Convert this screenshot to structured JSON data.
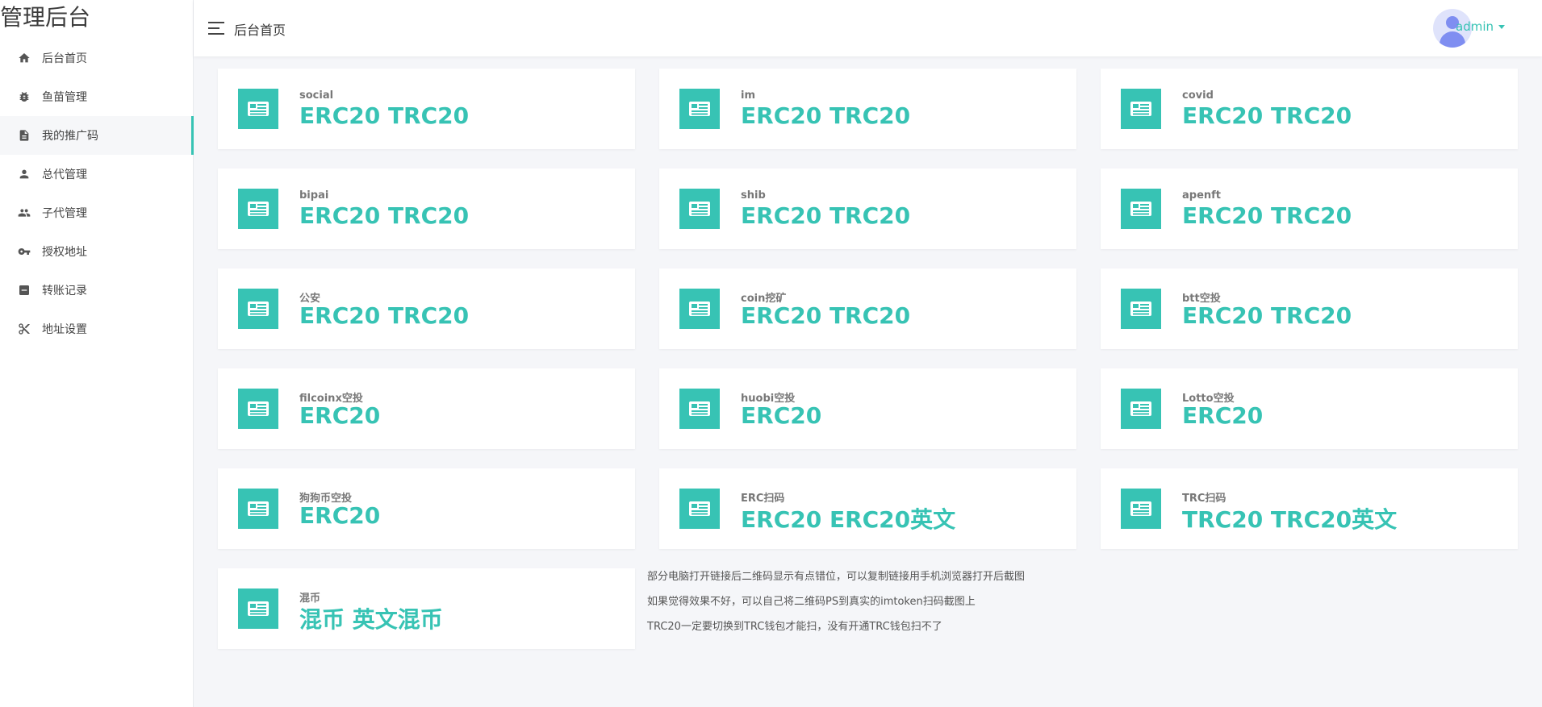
{
  "sidebar": {
    "brand": "管理后台",
    "items": [
      {
        "label": "后台首页",
        "icon": "home-icon"
      },
      {
        "label": "鱼苗管理",
        "icon": "bug-icon"
      },
      {
        "label": "我的推广码",
        "icon": "document-icon"
      },
      {
        "label": "总代管理",
        "icon": "person-icon"
      },
      {
        "label": "子代管理",
        "icon": "people-icon"
      },
      {
        "label": "授权地址",
        "icon": "key-icon"
      },
      {
        "label": "转账记录",
        "icon": "list-icon"
      },
      {
        "label": "地址设置",
        "icon": "scissors-icon"
      }
    ],
    "active_index": 2
  },
  "header": {
    "title": "后台首页",
    "user": "admin"
  },
  "cards": [
    {
      "label": "social",
      "value": "ERC20 TRC20"
    },
    {
      "label": "im",
      "value": "ERC20 TRC20"
    },
    {
      "label": "covid",
      "value": "ERC20 TRC20"
    },
    {
      "label": "bipai",
      "value": "ERC20 TRC20"
    },
    {
      "label": "shib",
      "value": "ERC20 TRC20"
    },
    {
      "label": "apenft",
      "value": "ERC20 TRC20"
    },
    {
      "label": "公安",
      "value": "ERC20 TRC20"
    },
    {
      "label": "coin挖矿",
      "value": "ERC20 TRC20"
    },
    {
      "label": "btt空投",
      "value": "ERC20 TRC20"
    },
    {
      "label": "filcoinx空投",
      "value": "ERC20"
    },
    {
      "label": "huobi空投",
      "value": "ERC20"
    },
    {
      "label": "Lotto空投",
      "value": "ERC20"
    },
    {
      "label": "狗狗币空投",
      "value": "ERC20"
    },
    {
      "label": "ERC扫码",
      "value": "ERC20 ERC20英文"
    },
    {
      "label": "TRC扫码",
      "value": "TRC20 TRC20英文"
    },
    {
      "label": "混币",
      "value": "混币 英文混币"
    }
  ],
  "notes": [
    "部分电脑打开链接后二维码显示有点错位，可以复制链接用手机浏览器打开后截图",
    "如果觉得效果不好，可以自己将二维码PS到真实的imtoken扫码截图上",
    "TRC20一定要切换到TRC钱包才能扫，没有开通TRC钱包扫不了"
  ],
  "colors": {
    "accent": "#37c3b4",
    "background": "#f5f6f9"
  }
}
